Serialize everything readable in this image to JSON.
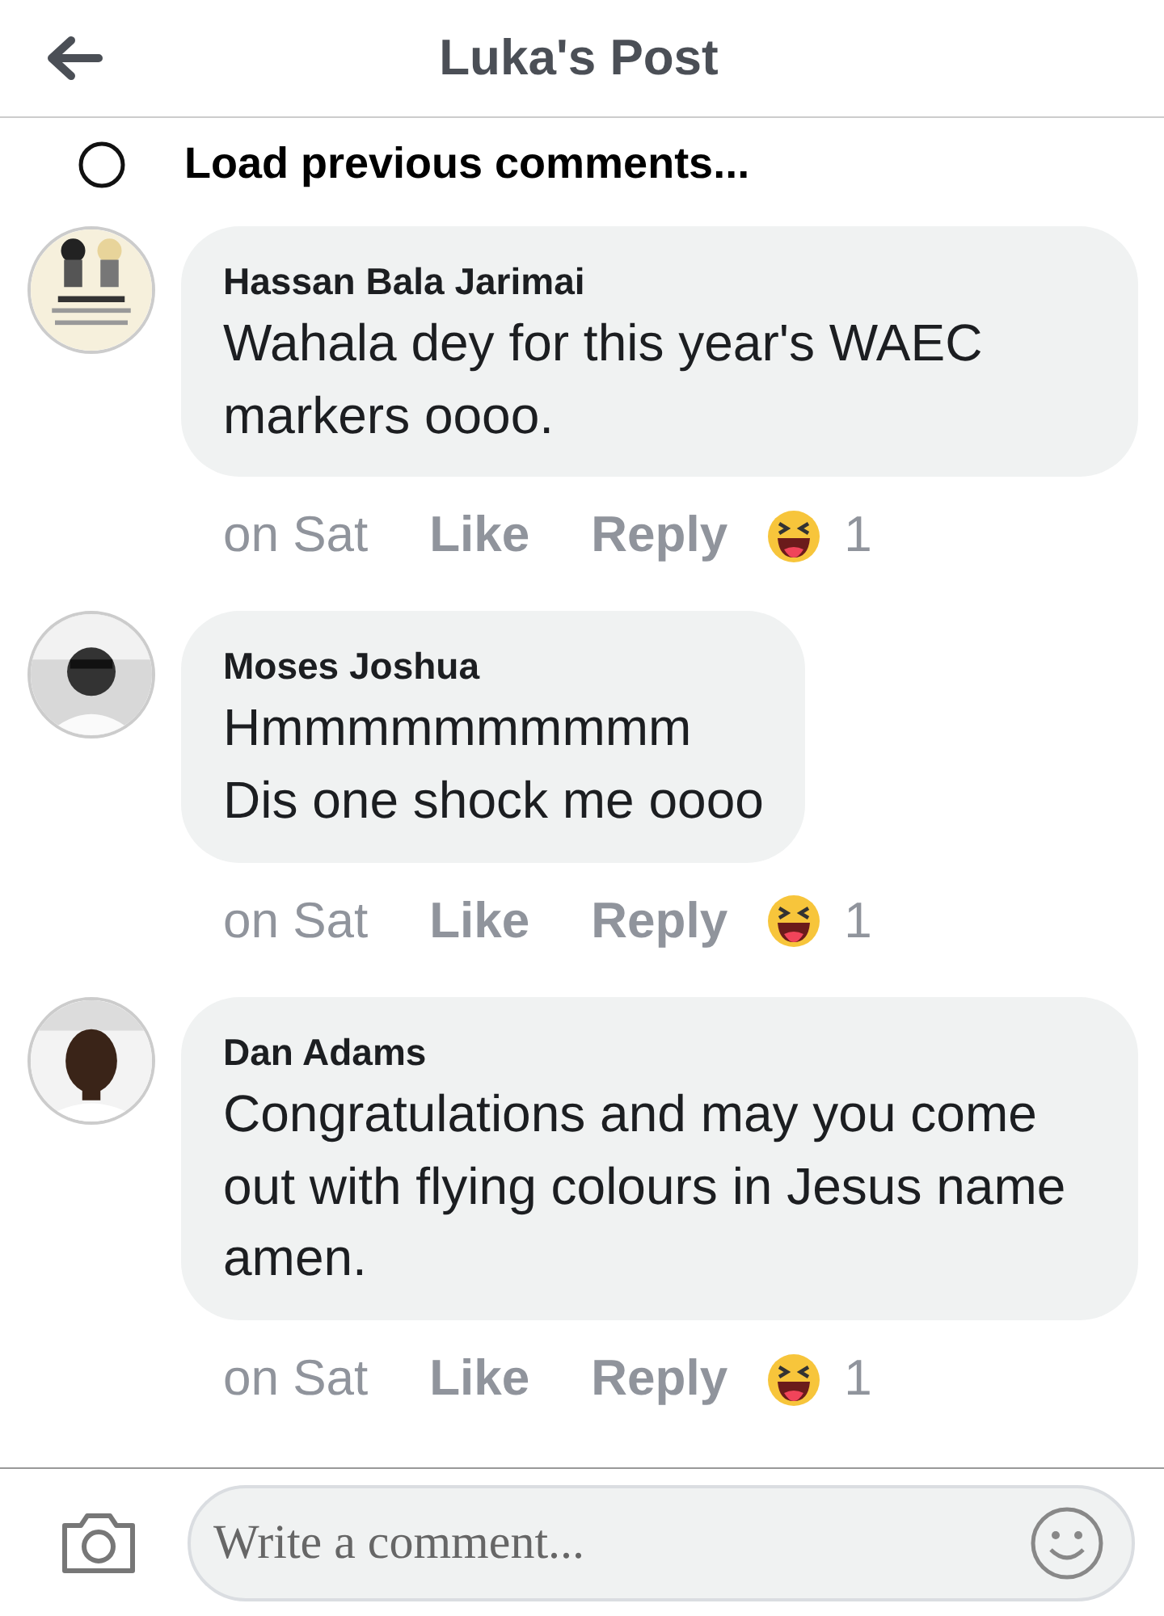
{
  "header": {
    "title": "Luka's Post"
  },
  "load_previous": {
    "label": "Load previous comments..."
  },
  "comments": [
    {
      "author": "Hassan Bala Jarimai",
      "text": "Wahala dey for this year's WAEC markers oooo.",
      "time": "on Sat",
      "like": "Like",
      "reply": "Reply",
      "reaction_count": "1"
    },
    {
      "author": "Moses Joshua",
      "text": "Hmmmmmmmmmm\nDis one shock me oooo",
      "time": "on Sat",
      "like": "Like",
      "reply": "Reply",
      "reaction_count": "1"
    },
    {
      "author": "Dan Adams",
      "text": "Congratulations and may you come out with flying colours in Jesus name amen.",
      "time": "on Sat",
      "like": "Like",
      "reply": "Reply",
      "reaction_count": "1"
    }
  ],
  "composer": {
    "placeholder": "Write a comment..."
  }
}
